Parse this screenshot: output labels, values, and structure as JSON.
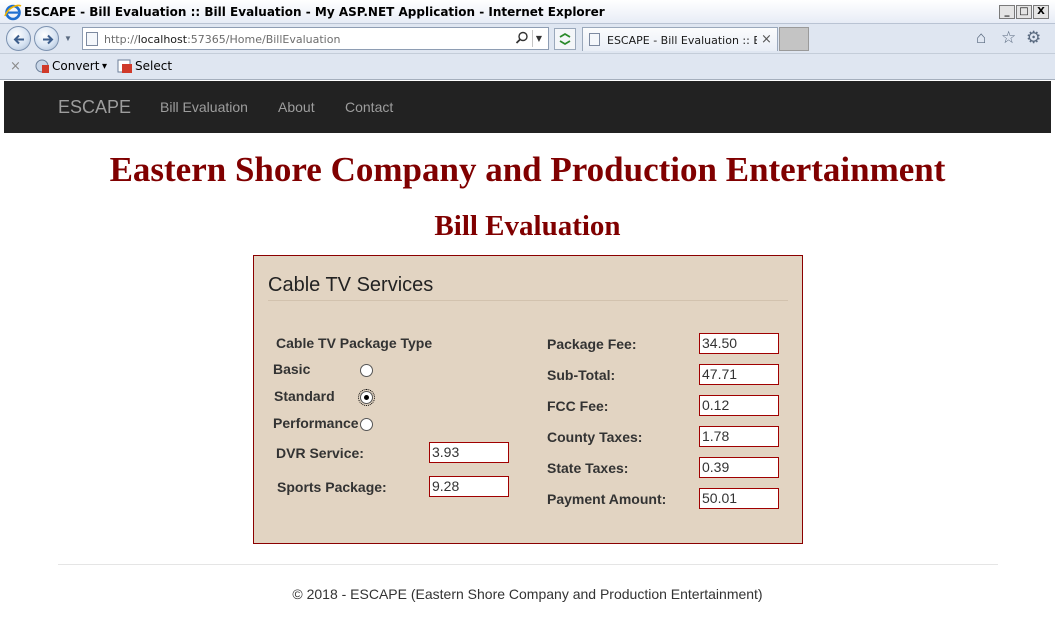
{
  "window": {
    "title": "ESCAPE - Bill Evaluation :: Bill Evaluation - My ASP.NET Application - Internet Explorer",
    "controls": [
      "_",
      "□",
      "X"
    ]
  },
  "browser": {
    "url_scheme": "http://",
    "url_host": "localhost",
    "url_path": ":57365/Home/BillEvaluation",
    "tab_title": "ESCAPE - Bill Evaluation :: Bill...",
    "tab_close": "×",
    "command_bar": {
      "close": "×",
      "convert": "Convert",
      "convert_drop": "▾",
      "select": "Select"
    }
  },
  "navbar": {
    "brand": "ESCAPE",
    "links": [
      "Bill Evaluation",
      "About",
      "Contact"
    ]
  },
  "page": {
    "company": "Eastern Shore Company and Production Entertainment",
    "title": "Bill Evaluation"
  },
  "panel": {
    "title": "Cable TV Services",
    "package_type_label": "Cable TV Package Type",
    "packages": [
      {
        "label": "Basic",
        "checked": false
      },
      {
        "label": "Standard",
        "checked": true
      },
      {
        "label": "Performance",
        "checked": false
      }
    ],
    "dvr_label": "DVR Service:",
    "dvr_value": "3.93",
    "sports_label": "Sports Package:",
    "sports_value": "9.28",
    "right_fields": [
      {
        "label": "Package Fee:",
        "value": "34.50"
      },
      {
        "label": "Sub-Total:",
        "value": "47.71"
      },
      {
        "label": "FCC Fee:",
        "value": "0.12"
      },
      {
        "label": "County Taxes:",
        "value": "1.78"
      },
      {
        "label": "State Taxes:",
        "value": "0.39"
      },
      {
        "label": "Payment Amount:",
        "value": "50.01"
      }
    ]
  },
  "footer": "© 2018 - ESCAPE (Eastern Shore Company and Production Entertainment)",
  "colors": {
    "heading": "#800000",
    "panel_bg": "#e2d4c2",
    "panel_border": "#8b0000",
    "navbar_bg": "#222222",
    "nav_text": "#9d9d9d"
  }
}
